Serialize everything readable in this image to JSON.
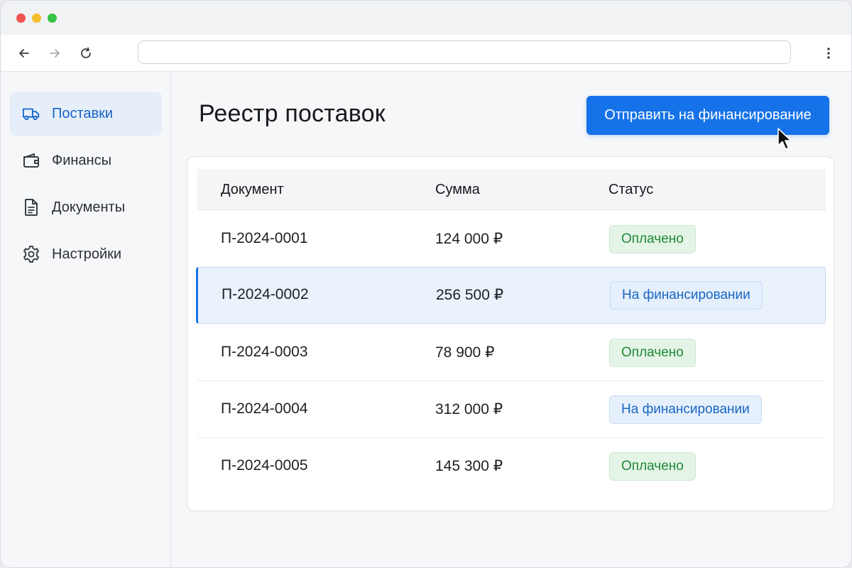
{
  "window": {
    "traffic_lights": [
      "close",
      "minimize",
      "maximize"
    ],
    "colors": {
      "close": "#f0524f",
      "minimize": "#f6bd2f",
      "maximize": "#37c346"
    }
  },
  "toolbar": {
    "back_icon": "arrow-left-icon",
    "forward_icon": "arrow-right-icon",
    "reload_icon": "reload-icon",
    "address_value": "",
    "menu_icon": "kebab-menu-icon"
  },
  "sidebar": {
    "items": [
      {
        "label": "Поставки",
        "icon": "truck-icon",
        "active": true
      },
      {
        "label": "Финансы",
        "icon": "wallet-icon",
        "active": false
      },
      {
        "label": "Документы",
        "icon": "document-icon",
        "active": false
      },
      {
        "label": "Настройки",
        "icon": "gear-icon",
        "active": false
      }
    ]
  },
  "main": {
    "title": "Реестр поставок",
    "primary_button": "Отправить на финансирование",
    "accent_color": "#1572e8"
  },
  "table": {
    "columns": [
      "Документ",
      "Сумма",
      "Статус"
    ],
    "rows": [
      {
        "document": "П-2024-0001",
        "amount": "124 000 ₽",
        "status": "Оплачено",
        "status_type": "paid",
        "selected": false
      },
      {
        "document": "П-2024-0002",
        "amount": "256 500 ₽",
        "status": "На финансировании",
        "status_type": "financing",
        "selected": true
      },
      {
        "document": "П-2024-0003",
        "amount": "78 900 ₽",
        "status": "Оплачено",
        "status_type": "paid",
        "selected": false
      },
      {
        "document": "П-2024-0004",
        "amount": "312 000 ₽",
        "status": "На финансировании",
        "status_type": "financing",
        "selected": false
      },
      {
        "document": "П-2024-0005",
        "amount": "145 300 ₽",
        "status": "Оплачено",
        "status_type": "paid",
        "selected": false
      }
    ]
  }
}
